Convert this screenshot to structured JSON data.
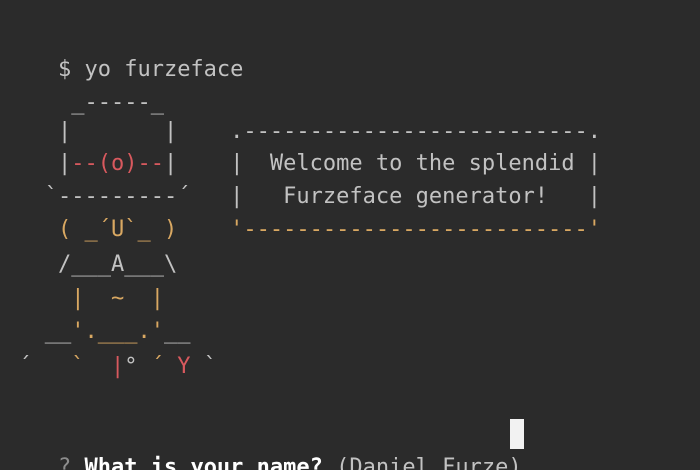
{
  "terminal": {
    "colors": {
      "background": "#2b2b2b",
      "text": "#d2d2d2",
      "red": "#d8595e",
      "yellow": "#d9a862",
      "prompt_mark": "#8d8d8d",
      "question": "#ffffff"
    },
    "command_line": "$ yo furzeface",
    "art_lines": [
      [
        {
          "t": "     _-----_",
          "c": "gray"
        }
      ],
      [
        {
          "t": "    |       |    ",
          "c": "gray"
        },
        {
          "t": ".--------------------------.",
          "c": "gray"
        }
      ],
      [
        {
          "t": "    |",
          "c": "gray"
        },
        {
          "t": "--(o)--",
          "c": "red"
        },
        {
          "t": "|    ",
          "c": "gray"
        },
        {
          "t": "|  Welcome to the splendid |",
          "c": "gray"
        }
      ],
      [
        {
          "t": "   `---------´   ",
          "c": "gray"
        },
        {
          "t": "|   Furzeface generator!   |",
          "c": "gray"
        }
      ],
      [
        {
          "t": "    ( _´U`_ )    ",
          "c": "yellow"
        },
        {
          "t": "'--------------------------'",
          "c": "yellow"
        }
      ],
      [
        {
          "t": "    /___A___\\",
          "c": "gray"
        }
      ],
      [
        {
          "t": "     |  ~  |",
          "c": "yellow"
        }
      ],
      [
        {
          "t": "   __",
          "c": "gray"
        },
        {
          "t": "'.___.'",
          "c": "yellow"
        },
        {
          "t": "__",
          "c": "gray"
        }
      ],
      [
        {
          "t": " ´   ",
          "c": "gray"
        },
        {
          "t": "`",
          "c": "yellow"
        },
        {
          "t": "  ",
          "c": "gray"
        },
        {
          "t": "|",
          "c": "red"
        },
        {
          "t": "° ",
          "c": "gray"
        },
        {
          "t": "´",
          "c": "yellow"
        },
        {
          "t": " ",
          "c": "gray"
        },
        {
          "t": "Y",
          "c": "red"
        },
        {
          "t": " `",
          "c": "gray"
        }
      ]
    ],
    "prompt": {
      "mark": "?",
      "question": "What is your name?",
      "default": "(Daniel Furze)"
    }
  }
}
